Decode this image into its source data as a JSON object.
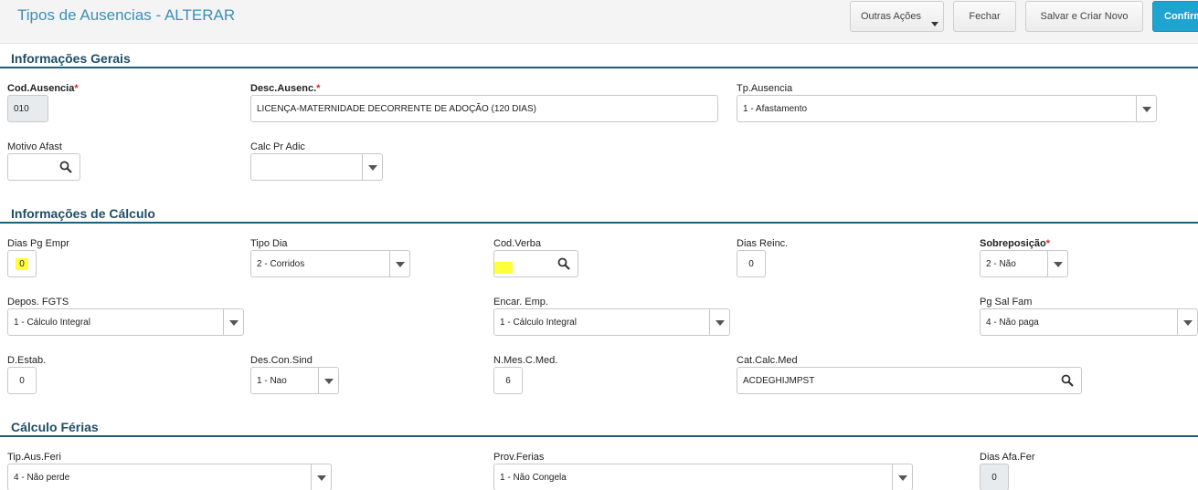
{
  "header": {
    "title": "Tipos de Ausencias - ALTERAR",
    "btn_more": "Outras Ações",
    "btn_close": "Fechar",
    "btn_save_new": "Salvar e Criar Novo",
    "btn_confirm": "Confirmar"
  },
  "sections": {
    "general": "Informações Gerais",
    "calc": "Informações de Cálculo",
    "vacation": "Cálculo Férias"
  },
  "fields": {
    "cod_ausencia": {
      "label": "Cod.Ausencia",
      "value": "010"
    },
    "desc_ausenc": {
      "label": "Desc.Ausenc.",
      "value": "LICENÇA-MATERNIDADE DECORRENTE DE ADOÇÃO (120 DIAS)"
    },
    "tp_ausencia": {
      "label": "Tp.Ausencia",
      "value": "1 - Afastamento"
    },
    "motivo_afast": {
      "label": "Motivo Afast",
      "value": ""
    },
    "calc_pr_adic": {
      "label": "Calc Pr Adic",
      "value": ""
    },
    "dias_pg_empr": {
      "label": "Dias Pg Empr",
      "value": "0"
    },
    "tipo_dia": {
      "label": "Tipo Dia",
      "value": "2 - Corridos"
    },
    "cod_verba": {
      "label": "Cod.Verba",
      "value": ""
    },
    "dias_reinc": {
      "label": "Dias Reinc.",
      "value": "0"
    },
    "sobreposicao": {
      "label": "Sobreposição",
      "value": "2 - Não"
    },
    "depos_fgts": {
      "label": "Depos. FGTS",
      "value": "1 - Cálculo Integral"
    },
    "encar_emp": {
      "label": "Encar. Emp.",
      "value": "1 - Cálculo Integral"
    },
    "pg_sal_fam": {
      "label": "Pg Sal Fam",
      "value": "4 - Não paga"
    },
    "d_estab": {
      "label": "D.Estab.",
      "value": "0"
    },
    "des_con_sind": {
      "label": "Des.Con.Sind",
      "value": "1 - Nao"
    },
    "n_mes_c_med": {
      "label": "N.Mes.C.Med.",
      "value": "6"
    },
    "cat_calc_med": {
      "label": "Cat.Calc.Med",
      "value": "ACDEGHIJMPST"
    },
    "tip_aus_feri": {
      "label": "Tip.Aus.Feri",
      "value": "4 - Não perde"
    },
    "prov_ferias": {
      "label": "Prov.Ferias",
      "value": "1 - Não Congela"
    },
    "dias_afa_fer": {
      "label": "Dias Afa.Fer",
      "value": "0"
    }
  },
  "colors": {
    "title": "#3b8fb8",
    "section": "#1f4e66",
    "confirm": "#1fa3cf",
    "highlight": "#ffff3a"
  }
}
